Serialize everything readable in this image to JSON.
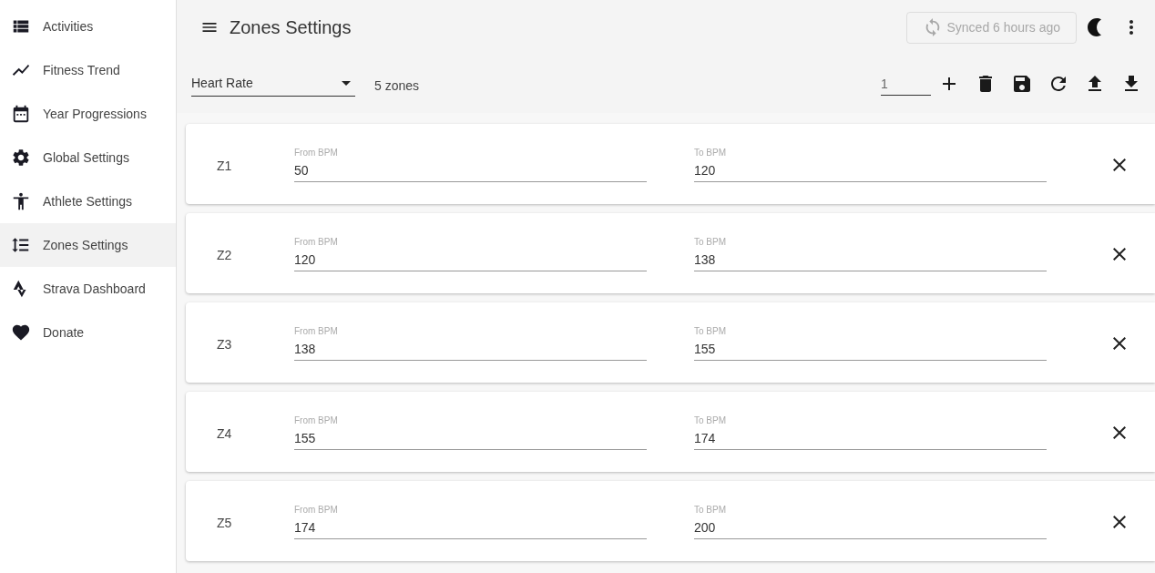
{
  "sidebar": {
    "items": [
      {
        "label": "Activities",
        "selected": false
      },
      {
        "label": "Fitness Trend",
        "selected": false
      },
      {
        "label": "Year Progressions",
        "selected": false
      },
      {
        "label": "Global Settings",
        "selected": false
      },
      {
        "label": "Athlete Settings",
        "selected": false
      },
      {
        "label": "Zones Settings",
        "selected": true
      },
      {
        "label": "Strava Dashboard",
        "selected": false
      },
      {
        "label": "Donate",
        "selected": false
      }
    ]
  },
  "toolbar": {
    "title": "Zones Settings",
    "sync_button": {
      "label": "Synced 6 hours ago",
      "disabled": true
    }
  },
  "zone_controls": {
    "zone_type": "Heart Rate",
    "zone_count": "5 zones",
    "step_value": "1"
  },
  "zones": [
    {
      "name": "Z1",
      "from_label": "From BPM",
      "from": "50",
      "to_label": "To BPM",
      "to": "120"
    },
    {
      "name": "Z2",
      "from_label": "From BPM",
      "from": "120",
      "to_label": "To BPM",
      "to": "138"
    },
    {
      "name": "Z3",
      "from_label": "From BPM",
      "from": "138",
      "to_label": "To BPM",
      "to": "155"
    },
    {
      "name": "Z4",
      "from_label": "From BPM",
      "from": "155",
      "to_label": "To BPM",
      "to": "174"
    },
    {
      "name": "Z5",
      "from_label": "From BPM",
      "from": "174",
      "to_label": "To BPM",
      "to": "200"
    }
  ]
}
